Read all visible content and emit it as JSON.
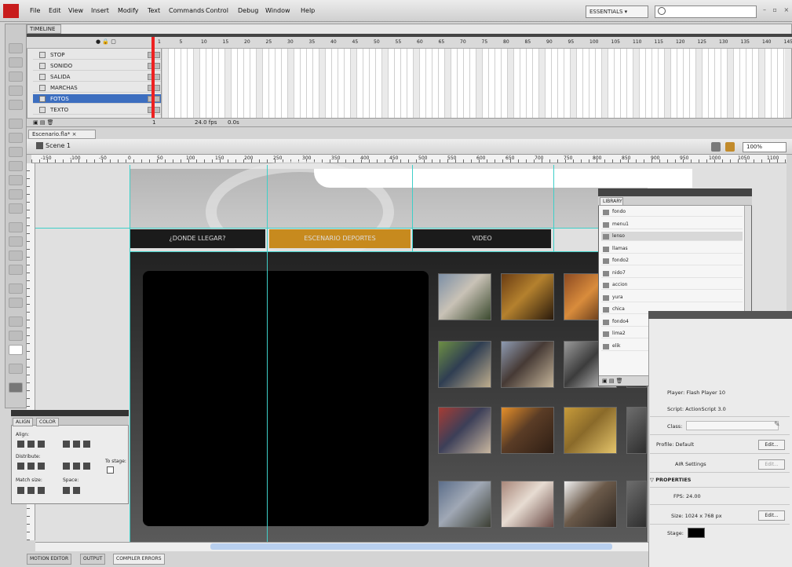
{
  "menubar": {
    "items": [
      "File",
      "Edit",
      "View",
      "Insert",
      "Modify",
      "Text",
      "Commands",
      "Control",
      "Debug",
      "Window",
      "Help"
    ],
    "workspace": "ESSENTIALS ▾",
    "search_placeholder": "",
    "window_controls": "– ▫ ×"
  },
  "timeline": {
    "tab": "TIMELINE",
    "ruler_numbers": [
      "1",
      "5",
      "10",
      "15",
      "20",
      "25",
      "30",
      "35",
      "40",
      "45",
      "50",
      "55",
      "60",
      "65",
      "70",
      "75",
      "80",
      "85",
      "90",
      "95",
      "100",
      "105",
      "110",
      "115",
      "120",
      "125",
      "130",
      "135",
      "140",
      "145"
    ],
    "layers": [
      {
        "name": "STOP",
        "selected": false
      },
      {
        "name": "SONIDO",
        "selected": false
      },
      {
        "name": "SALIDA",
        "selected": false
      },
      {
        "name": "MARCHAS",
        "selected": false
      },
      {
        "name": "FOTOS",
        "selected": true
      },
      {
        "name": "TEXTO",
        "selected": false
      }
    ],
    "footer": {
      "frame": "1",
      "fps": "24.0 fps",
      "time": "0.0s"
    }
  },
  "document": {
    "tab": "Escenario.fla* ×",
    "scene": "Scene 1",
    "zoom": "100%",
    "ruler_numbers": [
      "-150",
      "-100",
      "-50",
      "0",
      "50",
      "100",
      "150",
      "200",
      "250",
      "300",
      "350",
      "400",
      "450",
      "500",
      "550",
      "600",
      "650",
      "700",
      "750",
      "800",
      "850",
      "900",
      "950",
      "1000",
      "1050",
      "1100"
    ]
  },
  "stage": {
    "nav": [
      {
        "label": "¿DONDE LLEGAR?",
        "color": "#1b1b1b"
      },
      {
        "label": "ESCENARIO DEPORTES",
        "color": "#c78a1e"
      },
      {
        "label": "VIDEO",
        "color": "#1b1b1b"
      }
    ],
    "photos": [
      {
        "kind": "people-outdoors",
        "colors": [
          "#7c8fa6",
          "#c9c2b6",
          "#3b4a2f"
        ]
      },
      {
        "kind": "dark-crafts",
        "colors": [
          "#6a3c13",
          "#b4812e",
          "#2a1a0c"
        ]
      },
      {
        "kind": "dancers",
        "colors": [
          "#8c4a22",
          "#d98c3c",
          "#3a1c0e"
        ]
      },
      {
        "kind": "group-grass",
        "colors": [
          "#6d8f43",
          "#2f3e52",
          "#bfae8e"
        ]
      },
      {
        "kind": "crowd",
        "colors": [
          "#8e9bb2",
          "#463a35",
          "#c5b59a"
        ]
      },
      {
        "kind": "person",
        "colors": [
          "#9a9a9a",
          "#3c3c3c",
          "#dcdcdc"
        ]
      },
      {
        "kind": "festival",
        "colors": [
          "#a53c34",
          "#3c3f58",
          "#c9b7a0"
        ]
      },
      {
        "kind": "sunset",
        "colors": [
          "#e58f2a",
          "#5a3c26",
          "#2e1e14"
        ]
      },
      {
        "kind": "textiles",
        "colors": [
          "#c79b3a",
          "#8a6a2a",
          "#e5c56b"
        ]
      },
      {
        "kind": "mountains",
        "colors": [
          "#5c6e8a",
          "#a0a8b5",
          "#3c3f34"
        ]
      },
      {
        "kind": "flowers",
        "colors": [
          "#a8877a",
          "#e7dcd2",
          "#6a4a45"
        ]
      },
      {
        "kind": "canyon",
        "colors": [
          "#f2f2f2",
          "#6b5a4a",
          "#2e2620"
        ]
      }
    ]
  },
  "library": {
    "tab": "LIBRARY",
    "items": [
      "fondo",
      "menu1",
      "lenso",
      "llamas",
      "fondo2",
      "nido7",
      "accion",
      "yura",
      "chica",
      "fondo4",
      "lima2",
      "elik"
    ]
  },
  "align_panel": {
    "tabs": [
      "ALIGN",
      "COLOR"
    ],
    "align": "Align:",
    "distribute": "Distribute:",
    "match_size": "Match size:",
    "space": "Space:",
    "to_stage": "To stage:"
  },
  "properties": {
    "player": "Player: Flash Player 10",
    "script": "Script: ActionScript 3.0",
    "class_label": "Class:",
    "profile": "Profile: Default",
    "air_settings": "AIR Settings",
    "edit": "Edit...",
    "section": "▽ PROPERTIES",
    "fps": "FPS: 24.00",
    "size": "Size: 1024 x 768 px",
    "stage_label": "Stage:",
    "stage_color": "#000000"
  },
  "status_tabs": [
    "MOTION EDITOR",
    "OUTPUT",
    "COMPILER ERRORS"
  ]
}
